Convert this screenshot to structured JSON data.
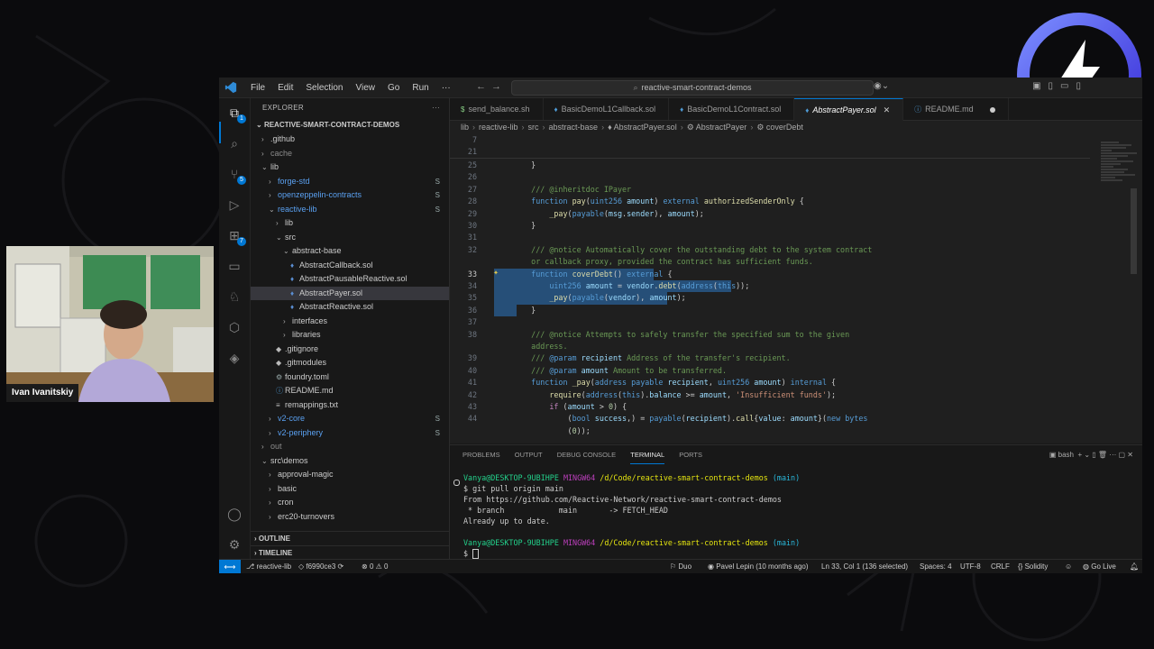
{
  "titlebar": {
    "menu": [
      "File",
      "Edit",
      "Selection",
      "View",
      "Go",
      "Run",
      "···"
    ],
    "command_center": "reactive-smart-contract-demos"
  },
  "explorer": {
    "header": "EXPLORER",
    "root": "REACTIVE-SMART-CONTRACT-DEMOS",
    "items": [
      {
        "label": ".github",
        "depth": 1,
        "kind": "folder",
        "open": false
      },
      {
        "label": "cache",
        "depth": 1,
        "kind": "folder",
        "open": false,
        "dim": true
      },
      {
        "label": "lib",
        "depth": 1,
        "kind": "folder",
        "open": true
      },
      {
        "label": "forge-std",
        "depth": 2,
        "kind": "folder",
        "open": false,
        "blue": true,
        "flag": "S"
      },
      {
        "label": "openzeppelin-contracts",
        "depth": 2,
        "kind": "folder",
        "open": false,
        "blue": true,
        "flag": "S"
      },
      {
        "label": "reactive-lib",
        "depth": 2,
        "kind": "folder",
        "open": true,
        "blue": true,
        "flag": "S"
      },
      {
        "label": "lib",
        "depth": 3,
        "kind": "folder",
        "open": false
      },
      {
        "label": "src",
        "depth": 3,
        "kind": "folder",
        "open": true
      },
      {
        "label": "abstract-base",
        "depth": 4,
        "kind": "folder",
        "open": true
      },
      {
        "label": "AbstractCallback.sol",
        "depth": 5,
        "kind": "sol"
      },
      {
        "label": "AbstractPausableReactive.sol",
        "depth": 5,
        "kind": "sol"
      },
      {
        "label": "AbstractPayer.sol",
        "depth": 5,
        "kind": "sol",
        "selected": true
      },
      {
        "label": "AbstractReactive.sol",
        "depth": 5,
        "kind": "sol"
      },
      {
        "label": "interfaces",
        "depth": 4,
        "kind": "folder",
        "open": false
      },
      {
        "label": "libraries",
        "depth": 4,
        "kind": "folder",
        "open": false
      },
      {
        "label": ".gitignore",
        "depth": 3,
        "kind": "git"
      },
      {
        "label": ".gitmodules",
        "depth": 3,
        "kind": "git"
      },
      {
        "label": "foundry.toml",
        "depth": 3,
        "kind": "toml"
      },
      {
        "label": "README.md",
        "depth": 3,
        "kind": "md"
      },
      {
        "label": "remappings.txt",
        "depth": 3,
        "kind": "txt"
      },
      {
        "label": "v2-core",
        "depth": 2,
        "kind": "folder",
        "open": false,
        "blue": true,
        "flag": "S"
      },
      {
        "label": "v2-periphery",
        "depth": 2,
        "kind": "folder",
        "open": false,
        "blue": true,
        "flag": "S"
      },
      {
        "label": "out",
        "depth": 1,
        "kind": "folder",
        "open": false,
        "dim": true
      },
      {
        "label": "src\\demos",
        "depth": 1,
        "kind": "folder",
        "open": true
      },
      {
        "label": "approval-magic",
        "depth": 2,
        "kind": "folder",
        "open": false
      },
      {
        "label": "basic",
        "depth": 2,
        "kind": "folder",
        "open": false
      },
      {
        "label": "cron",
        "depth": 2,
        "kind": "folder",
        "open": false
      },
      {
        "label": "erc20-turnovers",
        "depth": 2,
        "kind": "folder",
        "open": false
      }
    ],
    "outline": "OUTLINE",
    "timeline": "TIMELINE"
  },
  "tabs": [
    {
      "label": "send_balance.sh",
      "icon": "$"
    },
    {
      "label": "BasicDemoL1Callback.sol",
      "icon": "♦"
    },
    {
      "label": "BasicDemoL1Contract.sol",
      "icon": "♦"
    },
    {
      "label": "AbstractPayer.sol",
      "icon": "♦",
      "active": true
    },
    {
      "label": "README.md",
      "icon": "ⓘ",
      "modified": true
    }
  ],
  "breadcrumb": [
    "lib",
    "reactive-lib",
    "src",
    "abstract-base",
    "♦ AbstractPayer.sol",
    "⚙ AbstractPayer",
    "⚙ coverDebt"
  ],
  "editor": {
    "sticky": [
      {
        "n": "7",
        "t": ""
      },
      {
        "n": "21",
        "t": ""
      }
    ],
    "lines": [
      {
        "n": "25",
        "t": [
          [
            "    }",
            ""
          ]
        ]
      },
      {
        "n": "26",
        "t": [
          [
            "",
            ""
          ]
        ]
      },
      {
        "n": "27",
        "t": [
          [
            "    /// @inheritdoc IPayer",
            "c-com"
          ]
        ]
      },
      {
        "n": "28",
        "t": [
          [
            "    ",
            ""
          ],
          [
            "function",
            "c-kw"
          ],
          [
            " ",
            ""
          ],
          [
            "pay",
            "c-fn"
          ],
          [
            "(",
            ""
          ],
          [
            "uint256",
            "c-kw"
          ],
          [
            " ",
            ""
          ],
          [
            "amount",
            "c-var"
          ],
          [
            ") ",
            ""
          ],
          [
            "external",
            "c-kw"
          ],
          [
            " ",
            ""
          ],
          [
            "authorizedSenderOnly",
            "c-fn"
          ],
          [
            " {",
            ""
          ]
        ]
      },
      {
        "n": "29",
        "t": [
          [
            "        ",
            ""
          ],
          [
            "_pay",
            "c-fn"
          ],
          [
            "(",
            ""
          ],
          [
            "payable",
            "c-kw"
          ],
          [
            "(",
            ""
          ],
          [
            "msg",
            "c-var"
          ],
          [
            ".",
            ""
          ],
          [
            "sender",
            "c-var"
          ],
          [
            "), ",
            ""
          ],
          [
            "amount",
            "c-var"
          ],
          [
            ");",
            ""
          ]
        ]
      },
      {
        "n": "30",
        "t": [
          [
            "    }",
            ""
          ]
        ]
      },
      {
        "n": "31",
        "t": [
          [
            "",
            ""
          ]
        ]
      },
      {
        "n": "32",
        "t": [
          [
            "    /// @notice Automatically cover the outstanding debt to the system contract",
            "c-com"
          ]
        ]
      },
      {
        "n": "",
        "t": [
          [
            "    or callback proxy, provided the contract has sufficient funds.",
            "c-com"
          ]
        ]
      },
      {
        "n": "33",
        "t": [
          [
            "    ",
            ""
          ],
          [
            "function",
            "c-kw"
          ],
          [
            " ",
            ""
          ],
          [
            "coverDebt",
            "c-fn"
          ],
          [
            "() ",
            ""
          ],
          [
            "external",
            "c-kw"
          ],
          [
            " {",
            ""
          ]
        ],
        "sel": true,
        "cur": true
      },
      {
        "n": "34",
        "t": [
          [
            "        ",
            ""
          ],
          [
            "uint256",
            "c-kw"
          ],
          [
            " ",
            ""
          ],
          [
            "amount",
            "c-var"
          ],
          [
            " = ",
            ""
          ],
          [
            "vendor",
            "c-var"
          ],
          [
            ".",
            ""
          ],
          [
            "debt",
            "c-fn"
          ],
          [
            "(",
            ""
          ],
          [
            "address",
            "c-kw"
          ],
          [
            "(",
            ""
          ],
          [
            "this",
            "c-kw"
          ],
          [
            "));",
            ""
          ]
        ],
        "sel": true
      },
      {
        "n": "35",
        "t": [
          [
            "        ",
            ""
          ],
          [
            "_pay",
            "c-fn"
          ],
          [
            "(",
            ""
          ],
          [
            "payable",
            "c-kw"
          ],
          [
            "(",
            ""
          ],
          [
            "vendor",
            "c-var"
          ],
          [
            "), ",
            ""
          ],
          [
            "amount",
            "c-var"
          ],
          [
            ");",
            ""
          ]
        ],
        "sel": true
      },
      {
        "n": "36",
        "t": [
          [
            "    }",
            ""
          ]
        ],
        "sel": true
      },
      {
        "n": "37",
        "t": [
          [
            "",
            ""
          ]
        ]
      },
      {
        "n": "38",
        "t": [
          [
            "    /// @notice Attempts to safely transfer the specified sum to the given",
            "c-com"
          ]
        ]
      },
      {
        "n": "",
        "t": [
          [
            "    address.",
            "c-com"
          ]
        ]
      },
      {
        "n": "39",
        "t": [
          [
            "    /// ",
            "c-com"
          ],
          [
            "@param",
            "c-kw"
          ],
          [
            " ",
            ""
          ],
          [
            "recipient",
            "c-var"
          ],
          [
            " Address of the transfer's recipient.",
            "c-com"
          ]
        ]
      },
      {
        "n": "40",
        "t": [
          [
            "    /// ",
            "c-com"
          ],
          [
            "@param",
            "c-kw"
          ],
          [
            " ",
            ""
          ],
          [
            "amount",
            "c-var"
          ],
          [
            " Amount to be transferred.",
            "c-com"
          ]
        ]
      },
      {
        "n": "41",
        "t": [
          [
            "    ",
            ""
          ],
          [
            "function",
            "c-kw"
          ],
          [
            " ",
            ""
          ],
          [
            "_pay",
            "c-fn"
          ],
          [
            "(",
            ""
          ],
          [
            "address",
            "c-kw"
          ],
          [
            " ",
            ""
          ],
          [
            "payable",
            "c-kw"
          ],
          [
            " ",
            ""
          ],
          [
            "recipient",
            "c-var"
          ],
          [
            ", ",
            ""
          ],
          [
            "uint256",
            "c-kw"
          ],
          [
            " ",
            ""
          ],
          [
            "amount",
            "c-var"
          ],
          [
            ") ",
            ""
          ],
          [
            "internal",
            "c-kw"
          ],
          [
            " {",
            ""
          ]
        ]
      },
      {
        "n": "42",
        "t": [
          [
            "        ",
            ""
          ],
          [
            "require",
            "c-fn"
          ],
          [
            "(",
            ""
          ],
          [
            "address",
            "c-kw"
          ],
          [
            "(",
            ""
          ],
          [
            "this",
            "c-kw"
          ],
          [
            ").",
            ""
          ],
          [
            "balance",
            "c-var"
          ],
          [
            " >= ",
            ""
          ],
          [
            "amount",
            "c-var"
          ],
          [
            ", ",
            ""
          ],
          [
            "'Insufficient funds'",
            "c-str"
          ],
          [
            ");",
            ""
          ]
        ]
      },
      {
        "n": "43",
        "t": [
          [
            "        ",
            ""
          ],
          [
            "if",
            "c-ctl"
          ],
          [
            " (",
            ""
          ],
          [
            "amount",
            "c-var"
          ],
          [
            " > ",
            ""
          ],
          [
            "0",
            "c-num"
          ],
          [
            ") {",
            ""
          ]
        ]
      },
      {
        "n": "44",
        "t": [
          [
            "            (",
            ""
          ],
          [
            "bool",
            "c-kw"
          ],
          [
            " ",
            ""
          ],
          [
            "success",
            "c-var"
          ],
          [
            ",) = ",
            ""
          ],
          [
            "payable",
            "c-kw"
          ],
          [
            "(",
            ""
          ],
          [
            "recipient",
            "c-var"
          ],
          [
            ").",
            ""
          ],
          [
            "call",
            "c-fn"
          ],
          [
            "{",
            ""
          ],
          [
            "value",
            "c-var"
          ],
          [
            ": ",
            ""
          ],
          [
            "amount",
            "c-var"
          ],
          [
            "}(",
            ""
          ],
          [
            "new",
            "c-kw"
          ],
          [
            " ",
            ""
          ],
          [
            "bytes",
            "c-kw"
          ]
        ]
      },
      {
        "n": "",
        "t": [
          [
            "            (",
            ""
          ],
          [
            "0",
            "c-num"
          ],
          [
            "));",
            ""
          ]
        ]
      }
    ]
  },
  "panel": {
    "tabs": [
      "PROBLEMS",
      "OUTPUT",
      "DEBUG CONSOLE",
      "TERMINAL",
      "PORTS"
    ],
    "active_tab": "TERMINAL",
    "shell": "bash",
    "terminal": {
      "user": "Vanya@DESKTOP-9UBIHPE",
      "env": "MINGW64",
      "path": "/d/Code/reactive-smart-contract-demos",
      "branch": "(main)",
      "command": "$ git pull origin main",
      "out1": "From https://github.com/Reactive-Network/reactive-smart-contract-demos",
      "out2": " * branch            main       -> FETCH_HEAD",
      "out3": "Already up to date.",
      "prompt": "$ "
    }
  },
  "statusbar": {
    "branch": "reactive-lib",
    "commit": "f6990ce3",
    "problems": "0 ⚠ 0",
    "duo": "Duo",
    "blame": "Pavel Lepin (10 months ago)",
    "position": "Ln 33, Col 1 (136 selected)",
    "spaces": "Spaces: 4",
    "encoding": "UTF-8",
    "eol": "CRLF",
    "language": "Solidity",
    "golive": "Go Live"
  },
  "webcam": {
    "name": "Ivan Ivanitskiy"
  },
  "colors": {
    "accent": "#0078d4",
    "selection": "#264f78",
    "brand_ring": "#5a4be8"
  }
}
